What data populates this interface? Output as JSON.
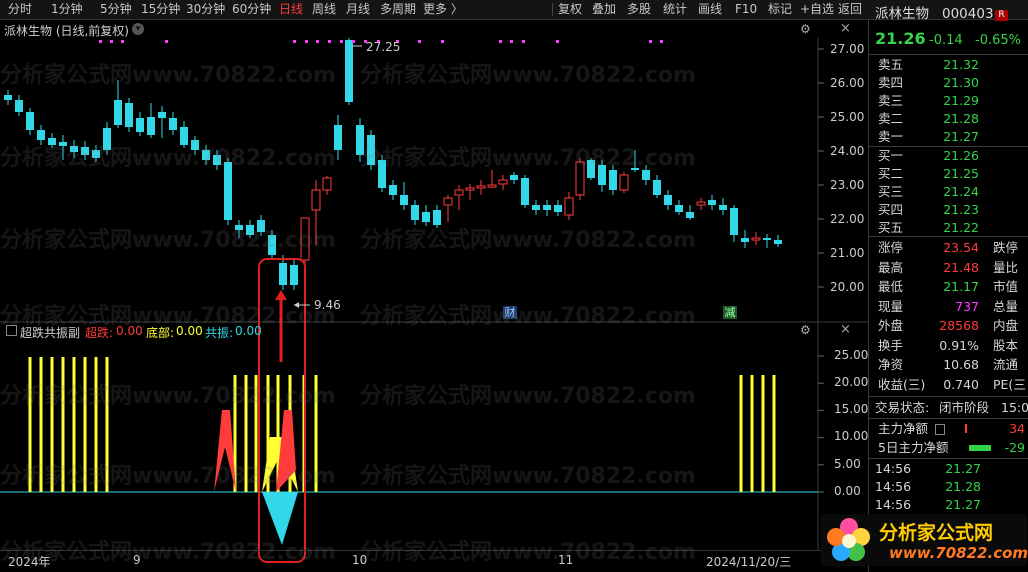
{
  "toolbar": {
    "period_tabs": [
      "分时",
      "1分钟",
      "5分钟",
      "15分钟",
      "30分钟",
      "60分钟",
      "日线",
      "周线",
      "月线",
      "多周期",
      "更多 〉"
    ],
    "active_period": "日线",
    "right_tools": [
      "复权",
      "叠加",
      "多股",
      "统计",
      "画线",
      "F10",
      "标记",
      "+自选",
      "返回"
    ]
  },
  "stock": {
    "name": "派林生物",
    "code": "000403",
    "badge": "R",
    "price": "21.26",
    "change": "-0.14",
    "change_pct": "-0.65%"
  },
  "main_chart": {
    "title": "派林生物 (日线,前复权)",
    "high_label": "27.25",
    "low_label": "9.46",
    "y_ticks": [
      "27.00",
      "26.00",
      "25.00",
      "24.00",
      "23.00",
      "22.00",
      "21.00",
      "20.00"
    ],
    "badges": {
      "cai": "财",
      "jian": "减"
    }
  },
  "indicator": {
    "title": "超跌共振副",
    "legend": [
      {
        "name": "超跌:",
        "value": "0.00",
        "color": "#ff3b3b"
      },
      {
        "name": "底部:",
        "value": "0.00",
        "color": "#ffff33"
      },
      {
        "name": "共振:",
        "value": "0.00",
        "color": "#33d8e8"
      }
    ],
    "y_ticks": [
      "25.00",
      "20.00",
      "15.00",
      "10.00",
      "5.00",
      "0.00"
    ]
  },
  "date_axis": {
    "labels": [
      "2024年",
      "9",
      "10",
      "11"
    ],
    "current": "2024/11/20/三"
  },
  "order_book": {
    "asks": [
      {
        "label": "卖五",
        "price": "21.32"
      },
      {
        "label": "卖四",
        "price": "21.30"
      },
      {
        "label": "卖三",
        "price": "21.29"
      },
      {
        "label": "卖二",
        "price": "21.28"
      },
      {
        "label": "卖一",
        "price": "21.27"
      }
    ],
    "bids": [
      {
        "label": "买一",
        "price": "21.26"
      },
      {
        "label": "买二",
        "price": "21.25"
      },
      {
        "label": "买三",
        "price": "21.24"
      },
      {
        "label": "买四",
        "price": "21.23"
      },
      {
        "label": "买五",
        "price": "21.22"
      }
    ]
  },
  "quote_stats": [
    {
      "label": "涨停",
      "value": "23.54",
      "color": "up",
      "label2": "跌停"
    },
    {
      "label": "最高",
      "value": "21.48",
      "color": "up",
      "label2": "量比"
    },
    {
      "label": "最低",
      "value": "21.17",
      "color": "dn",
      "label2": "市值"
    },
    {
      "label": "现量",
      "value": "737",
      "color": "mg",
      "label2": "总量"
    },
    {
      "label": "外盘",
      "value": "28568",
      "color": "up",
      "label2": "内盘"
    },
    {
      "label": "换手",
      "value": "0.91%",
      "color": "wt",
      "label2": "股本"
    },
    {
      "label": "净资",
      "value": "10.68",
      "color": "wt",
      "label2": "流通"
    },
    {
      "label": "收益(三)",
      "value": "0.740",
      "color": "wt",
      "label2": "PE(三"
    }
  ],
  "trade_status": {
    "label": "交易状态:",
    "value": "闭市阶段",
    "time": "15:0"
  },
  "fund_flow": [
    {
      "label": "主力净额",
      "value": "34"
    },
    {
      "label": "5日主力净额",
      "value": "-29"
    }
  ],
  "ticks": [
    {
      "time": "14:56",
      "price": "21.27"
    },
    {
      "time": "14:56",
      "price": "21.28"
    },
    {
      "time": "14:56",
      "price": "21.27"
    }
  ],
  "watermark": {
    "text": "分析家公式网www.70822.com",
    "logo_name": "分析家公式网",
    "logo_url": "www.70822.com"
  },
  "colors": {
    "up": "#ff3b3b",
    "down": "#33d8e8",
    "yellow": "#ffff33",
    "highlight": "#e02020"
  }
}
